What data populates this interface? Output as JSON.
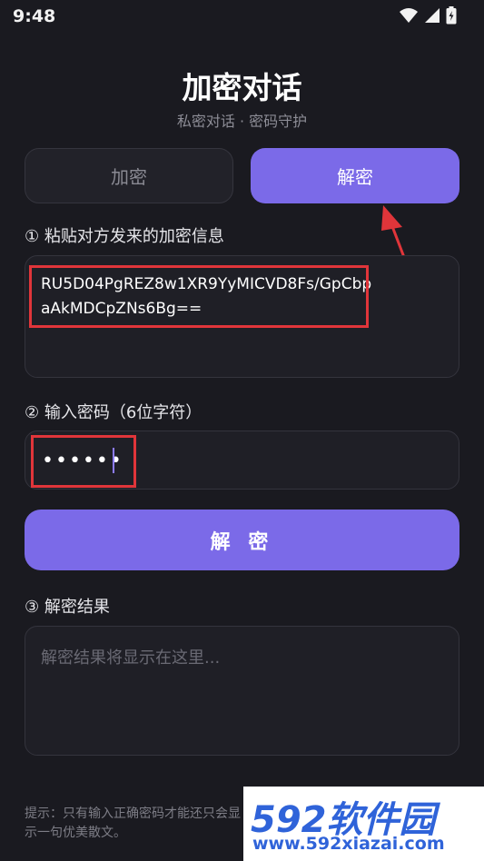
{
  "status": {
    "time": "9:48",
    "icons": [
      "wifi-icon",
      "signal-icon",
      "battery-icon"
    ]
  },
  "header": {
    "title": "加密对话",
    "subtitle": "私密对话 · 密码守护"
  },
  "tabs": [
    {
      "label": "加密",
      "active": false
    },
    {
      "label": "解密",
      "active": true
    }
  ],
  "cipher": {
    "label": "① 粘贴对方发来的加密信息",
    "value": "RU5D04PgREZ8w1XR9YyMICVD8Fs/GpCbpaAkMDCpZNs6Bg=="
  },
  "password": {
    "label": "② 输入密码（6位字符）",
    "value": "••••••"
  },
  "action": {
    "decrypt_label": "解 密"
  },
  "result": {
    "label": "③ 解密结果",
    "placeholder": "解密结果将显示在这里..."
  },
  "hint": {
    "text": "提示：只有输入正确密码才能还只会显示一句优美散文。"
  },
  "watermark": {
    "brand": "592软件园",
    "url": "www.592xiazai.com"
  },
  "colors": {
    "accent": "#7b6ae8",
    "background": "#1a1a20",
    "highlight": "#e0353a"
  }
}
